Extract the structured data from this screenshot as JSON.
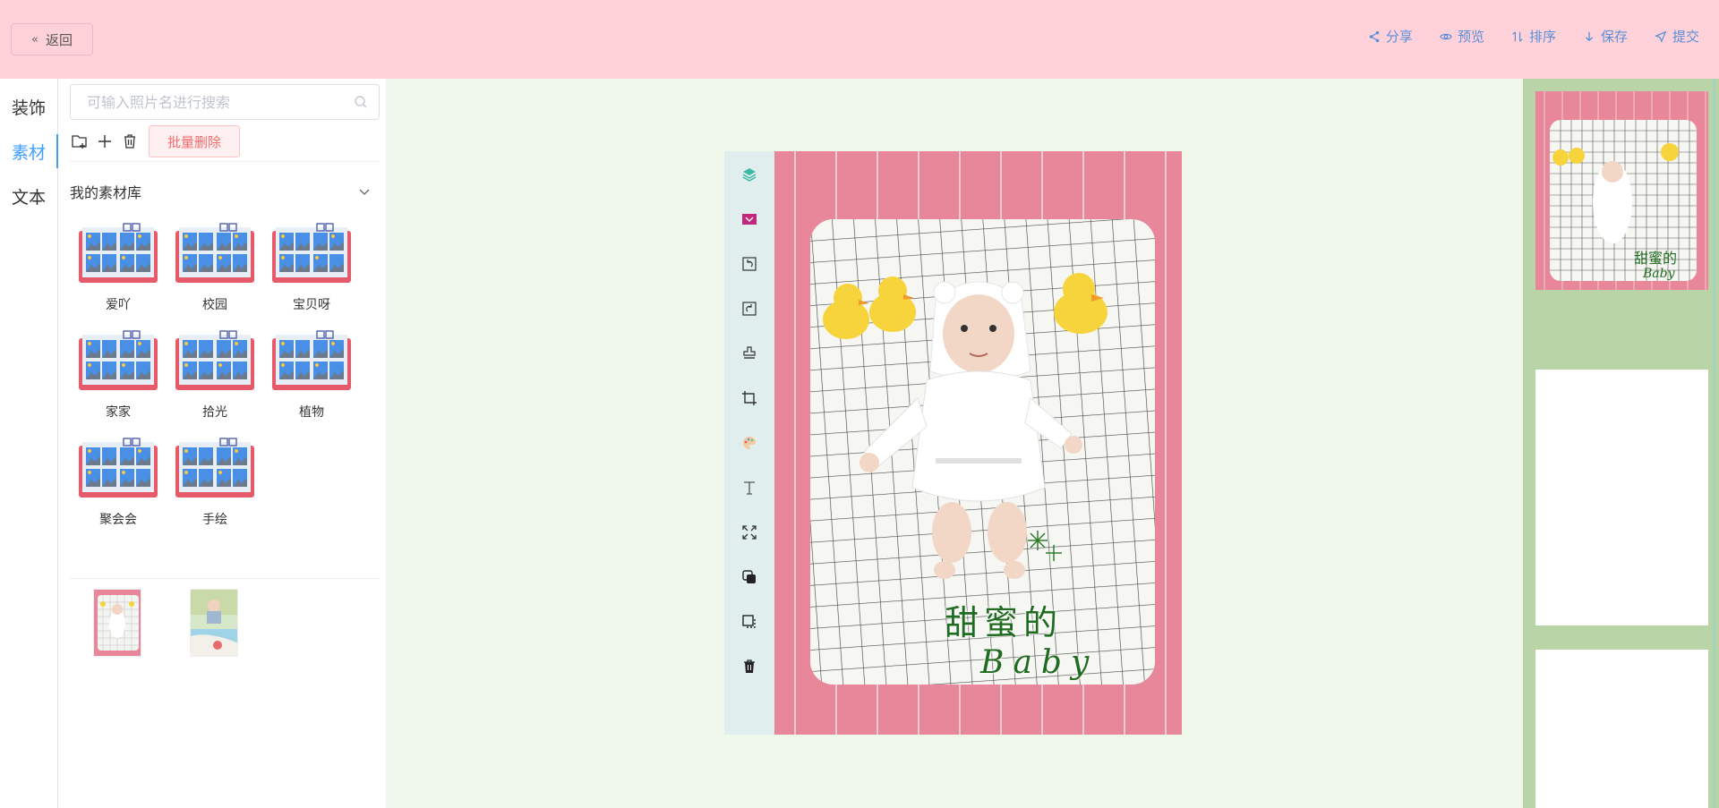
{
  "header": {
    "back_label": "返回",
    "actions": [
      {
        "label": "分享",
        "icon": "share-icon"
      },
      {
        "label": "预览",
        "icon": "eye-icon"
      },
      {
        "label": "排序",
        "icon": "sort-icon"
      },
      {
        "label": "保存",
        "icon": "download-icon"
      },
      {
        "label": "提交",
        "icon": "send-icon"
      }
    ]
  },
  "nav": {
    "items": [
      {
        "label": "装饰",
        "active": false
      },
      {
        "label": "素材",
        "active": true
      },
      {
        "label": "文本",
        "active": false
      }
    ]
  },
  "library": {
    "search_placeholder": "可输入照片名进行搜索",
    "batch_delete_label": "批量删除",
    "section_title": "我的素材库",
    "albums": [
      "爱吖",
      "校园",
      "宝贝呀",
      "家家",
      "拾光",
      "植物",
      "聚会会",
      "手绘"
    ]
  },
  "canvas": {
    "title_text_line1": "甜蜜的",
    "title_text_line2": "Baby"
  },
  "colors": {
    "header_bg": "#ffd2da",
    "accent": "#409eff",
    "page_pink": "#e8879a",
    "workarea_bg": "#f0f8eb",
    "toolbar_bg": "#e0eeee",
    "pages_bg": "#b9d4a6"
  }
}
